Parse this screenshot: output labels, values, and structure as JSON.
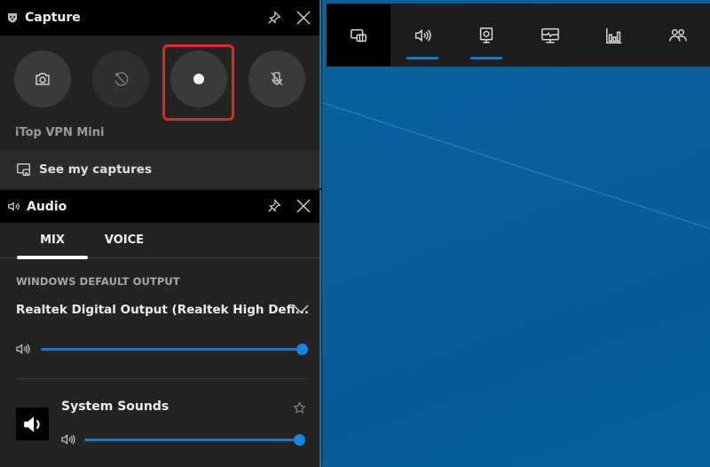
{
  "colors": {
    "accent": "#1b77c4",
    "record_highlight": "#e8261d",
    "desktop": "#06609f",
    "panel_bg": "#232323",
    "header_bg": "#000000"
  },
  "topbar": {
    "items": [
      {
        "name": "widget-menu",
        "icon": "widget-menu-icon",
        "active": false,
        "home": true
      },
      {
        "name": "audio",
        "icon": "speaker-icon",
        "active": true
      },
      {
        "name": "capture",
        "icon": "webcam-icon",
        "active": true
      },
      {
        "name": "performance",
        "icon": "monitor-graph-icon",
        "active": false
      },
      {
        "name": "resources",
        "icon": "bar-chart-icon",
        "active": false
      },
      {
        "name": "social",
        "icon": "people-icon",
        "active": false
      }
    ]
  },
  "capture": {
    "title": "Capture",
    "icon": "xbox-shield-icon",
    "buttons": [
      {
        "name": "screenshot",
        "icon": "camera-icon"
      },
      {
        "name": "record-last-30s",
        "icon": "replay-disabled-icon"
      },
      {
        "name": "start-recording",
        "icon": "record-dot-icon",
        "highlighted": true
      },
      {
        "name": "mic-toggle",
        "icon": "mic-off-icon"
      }
    ],
    "app_name": "iTop VPN Mini",
    "see_captures_label": "See my captures"
  },
  "audio": {
    "title": "Audio",
    "tabs": [
      {
        "label": "MIX",
        "active": true
      },
      {
        "label": "VOICE",
        "active": false
      }
    ],
    "section_label": "WINDOWS DEFAULT OUTPUT",
    "output_device": "Realtek Digital Output (Realtek High Defi...",
    "master_volume_pct": 100,
    "apps": [
      {
        "name": "System Sounds",
        "volume_pct": 100,
        "favorite": false
      }
    ]
  }
}
